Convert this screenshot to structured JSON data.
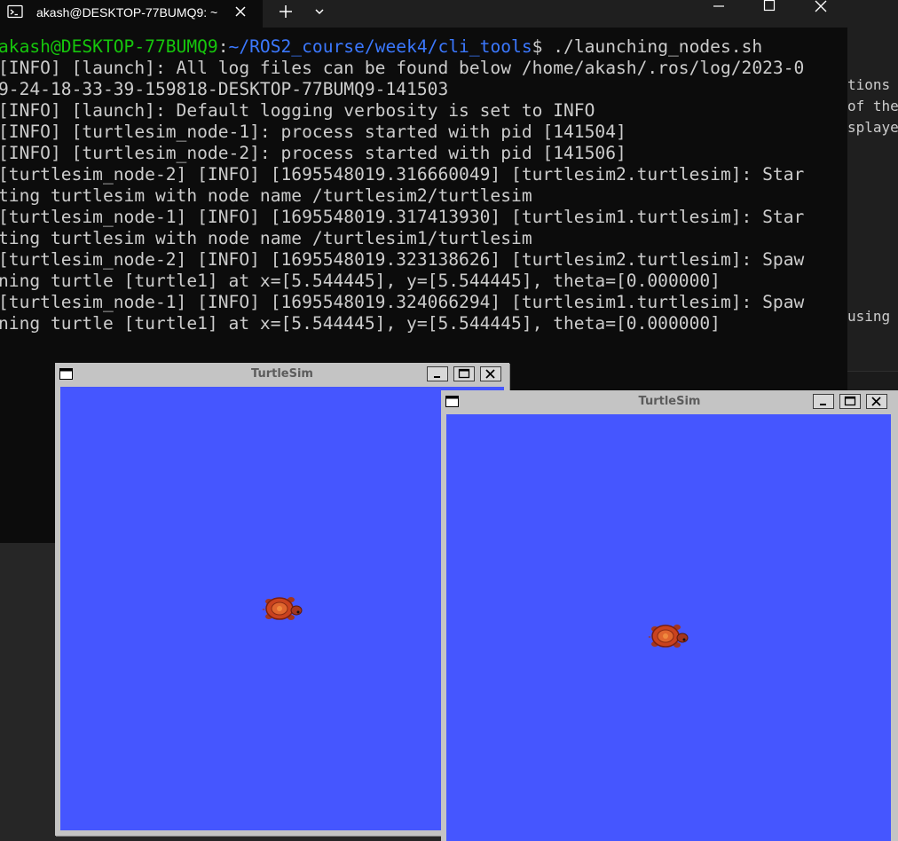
{
  "background_editor": {
    "lines": [
      "tions i",
      "of the",
      "splayed",
      "using"
    ]
  },
  "terminal": {
    "tab_title": "akash@DESKTOP-77BUMQ9: ~",
    "icons": {
      "tab": "terminal-icon",
      "close": "close-icon",
      "new_tab": "plus-icon",
      "dropdown": "chevron-down-icon",
      "minimize": "minimize-icon",
      "maximize": "maximize-icon",
      "window_close": "close-icon"
    },
    "colors": {
      "background": "#0c0c0c",
      "text": "#cccccc",
      "prompt_user": "#16c60c",
      "prompt_path": "#3b78ff"
    },
    "prompt": {
      "user": "akash@DESKTOP-77BUMQ9",
      "sep": ":",
      "path": "~/ROS2_course/week4/cli_tools",
      "dollar": "$",
      "command": " ./launching_nodes.sh"
    },
    "output_lines": [
      "[INFO] [launch]: All log files can be found below /home/akash/.ros/log/2023-0",
      "9-24-18-33-39-159818-DESKTOP-77BUMQ9-141503",
      "[INFO] [launch]: Default logging verbosity is set to INFO",
      "[INFO] [turtlesim_node-1]: process started with pid [141504]",
      "[INFO] [turtlesim_node-2]: process started with pid [141506]",
      "[turtlesim_node-2] [INFO] [1695548019.316660049] [turtlesim2.turtlesim]: Star",
      "ting turtlesim with node name /turtlesim2/turtlesim",
      "[turtlesim_node-1] [INFO] [1695548019.317413930] [turtlesim1.turtlesim]: Star",
      "ting turtlesim with node name /turtlesim1/turtlesim",
      "[turtlesim_node-2] [INFO] [1695548019.323138626] [turtlesim2.turtlesim]: Spaw",
      "ning turtle [turtle1] at x=[5.544445], y=[5.544445], theta=[0.000000]",
      "[turtlesim_node-1] [INFO] [1695548019.324066294] [turtlesim1.turtlesim]: Spaw",
      "ning turtle [turtle1] at x=[5.544445], y=[5.544445], theta=[0.000000]"
    ]
  },
  "turtlesim_windows": [
    {
      "title": "TurtleSim",
      "canvas_color": "#4556ff",
      "icons": [
        "window-menu-icon",
        "minimize-icon",
        "maximize-icon",
        "close-icon"
      ],
      "turtle_icon": "turtle-icon"
    },
    {
      "title": "TurtleSim",
      "canvas_color": "#4556ff",
      "icons": [
        "window-menu-icon",
        "minimize-icon",
        "maximize-icon",
        "close-icon"
      ],
      "turtle_icon": "turtle-icon"
    }
  ]
}
